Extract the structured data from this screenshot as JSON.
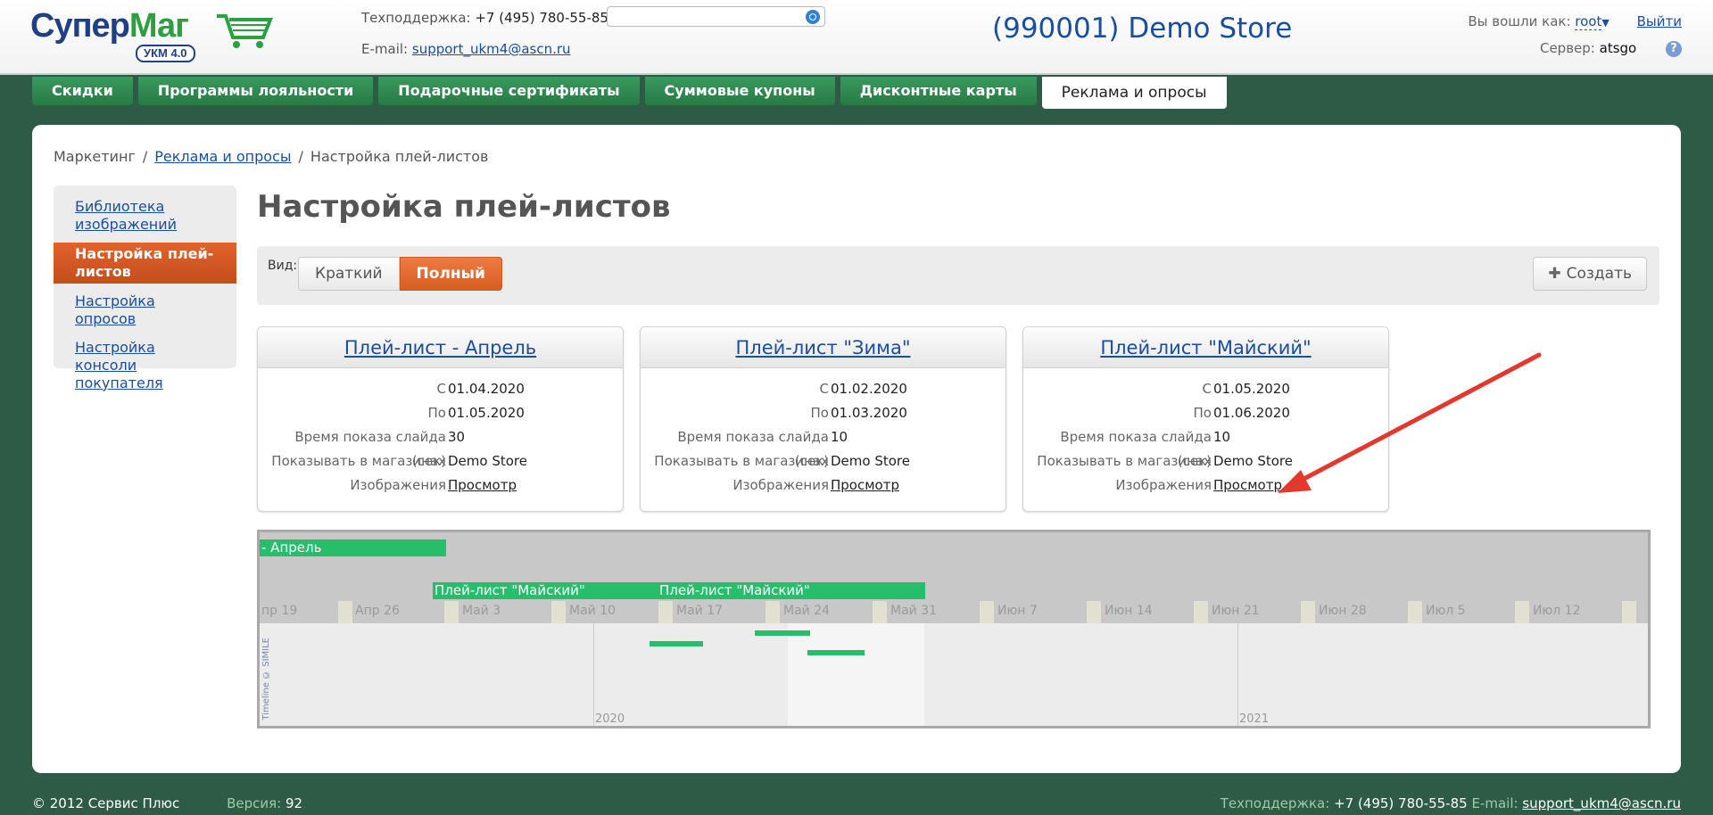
{
  "header": {
    "logo_main": "Супер",
    "logo_accent": "Маг",
    "logo_badge": "УКМ 4.0",
    "support_label": "Техподдержка:",
    "support_phone": "+7 (495) 780-55-85",
    "email_label": "E-mail:",
    "email": "support_ukm4@ascn.ru",
    "search_placeholder": "",
    "store_title": "(990001) Demo Store",
    "logged_as_label": "Вы вошли как:",
    "user": "root",
    "logout": "Выйти",
    "server_label": "Сервер:",
    "server": "atsgo",
    "help": "?"
  },
  "tabs": [
    {
      "label": "Скидки"
    },
    {
      "label": "Программы лояльности"
    },
    {
      "label": "Подарочные сертификаты"
    },
    {
      "label": "Суммовые купоны"
    },
    {
      "label": "Дисконтные карты"
    },
    {
      "label": "Реклама и опросы"
    }
  ],
  "breadcrumb": {
    "root": "Маркетинг",
    "parent": "Реклама и опросы",
    "current": "Настройка плей-листов",
    "sep": "/"
  },
  "sidebar": [
    {
      "label": "Библиотека изображений"
    },
    {
      "label": "Настройка плей-листов"
    },
    {
      "label": "Настройка опросов"
    },
    {
      "label": "Настройка консоли покупателя"
    }
  ],
  "page_title": "Настройка плей-листов",
  "toolbar": {
    "view_label": "Вид:",
    "brief": "Краткий",
    "full": "Полный",
    "create": "Создать"
  },
  "field_labels": {
    "from": "С",
    "to": "По",
    "slide_time": "Время показа слайда (сек)",
    "stores": "Показывать в магазинах",
    "images": "Изображения"
  },
  "playlists": [
    {
      "title": "Плей-лист - Апрель",
      "from": "01.04.2020",
      "to": "01.05.2020",
      "slide_time": "30",
      "stores": "Demo Store",
      "images": "Просмотр"
    },
    {
      "title": "Плей-лист \"Зима\"",
      "from": "01.02.2020",
      "to": "01.03.2020",
      "slide_time": "10",
      "stores": "Demo Store",
      "images": "Просмотр"
    },
    {
      "title": "Плей-лист \"Майский\"",
      "from": "01.05.2020",
      "to": "01.06.2020",
      "slide_time": "10",
      "stores": "Demo Store",
      "images": "Просмотр"
    }
  ],
  "timeline": {
    "events": [
      "- Апрель",
      "Плей-лист \"Майский\"",
      "Плей-лист \"Майский\""
    ],
    "week_labels": [
      "пр 19",
      "Апр 26",
      "Май 3",
      "Май 10",
      "Май 17",
      "Май 24",
      "Май 31",
      "Июн 7",
      "Июн 14",
      "Июн 21",
      "Июн 28",
      "Июл 5",
      "Июл 12"
    ],
    "years": [
      "2020",
      "2021"
    ],
    "copyright": "Timeline © SIMILE"
  },
  "footer": {
    "copyright": "© 2012 Сервис Плюс",
    "version_label": "Версия:",
    "version": "92",
    "support_label": "Техподдержка:",
    "support_phone": "+7 (495) 780-55-85",
    "email_label": "E-mail:",
    "email": "support_ukm4@ascn.ru"
  }
}
